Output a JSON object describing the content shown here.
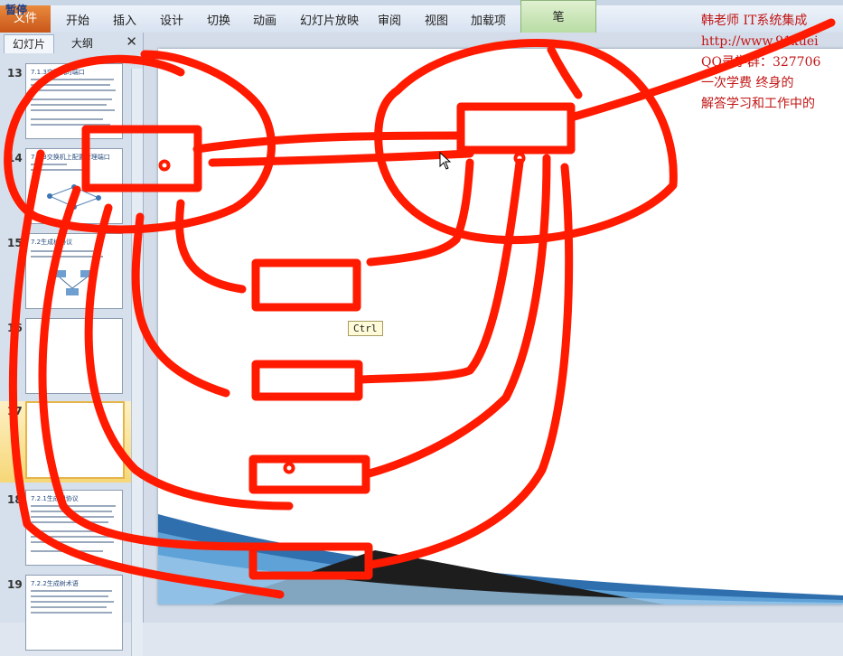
{
  "ribbon": {
    "pause_tag": "暂停",
    "file_tab": "文件",
    "tabs": [
      "开始",
      "插入",
      "设计",
      "切换",
      "动画",
      "幻灯片放映",
      "审阅",
      "视图",
      "加载项"
    ],
    "pen_tab": "笔"
  },
  "panel": {
    "tab_slides": "幻灯片",
    "tab_outline": "大纲",
    "close": "✕",
    "slides": [
      {
        "num": "13",
        "title": "7.1.3交换机的端口"
      },
      {
        "num": "14",
        "title": "7.1.3交换机上配置管理端口"
      },
      {
        "num": "15",
        "title": "7.2生成树协议"
      },
      {
        "num": "16",
        "title": ""
      },
      {
        "num": "17",
        "title": ""
      },
      {
        "num": "18",
        "title": "7.2.1生成树协议"
      },
      {
        "num": "19",
        "title": "7.2.2生成树术语"
      }
    ],
    "selected_slide": "17"
  },
  "tooltip": {
    "ctrl": "Ctrl"
  },
  "watermark": {
    "lines": [
      "韩老师 IT系统集成",
      "http://www.91xuei",
      " QQ录学群：327706",
      " 一次学费  终身的",
      "解答学习和工作中的"
    ]
  },
  "colors": {
    "ink": "#ff1a00",
    "watermark": "#c21515",
    "file_tab": "#d9672a"
  },
  "icons": [
    "cursor-arrow-icon",
    "close-icon"
  ]
}
